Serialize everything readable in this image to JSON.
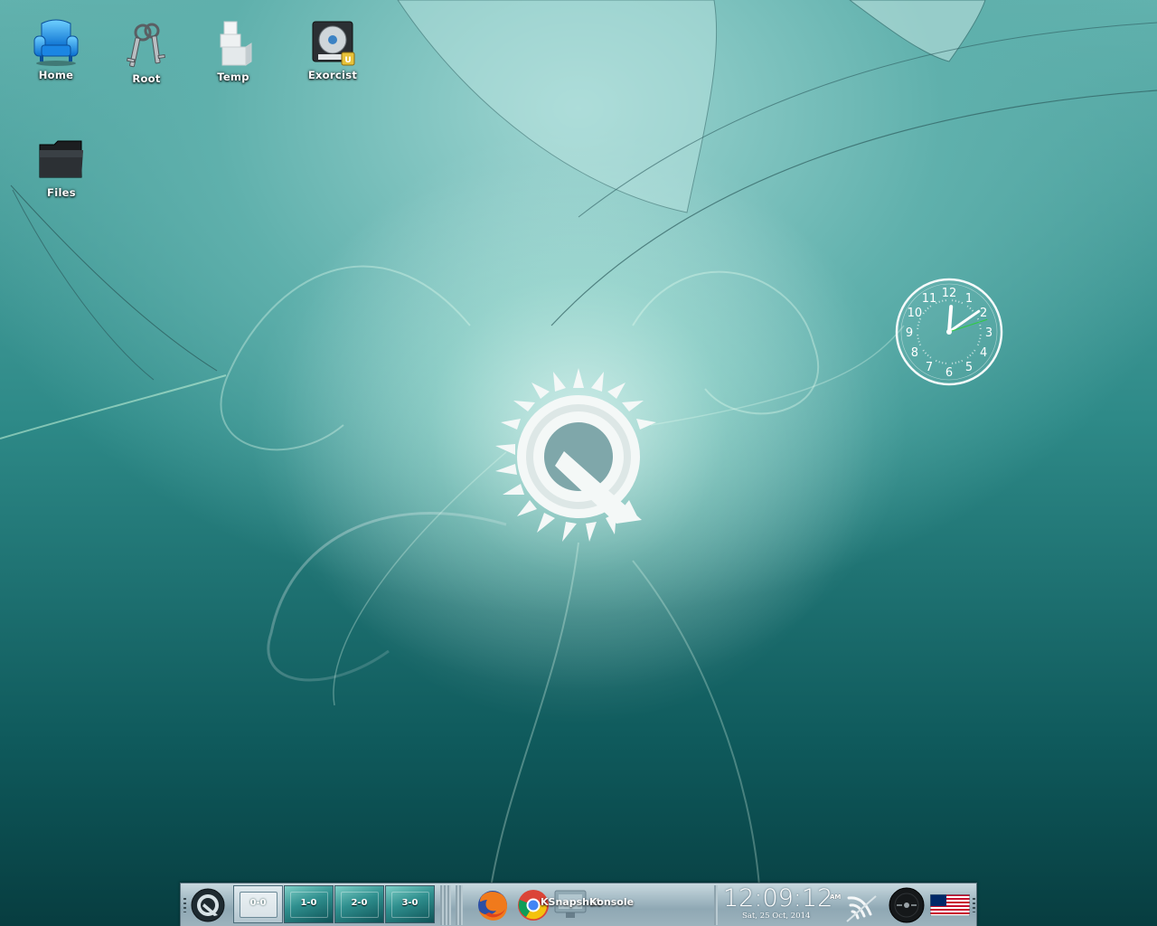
{
  "desktop": {
    "icons": [
      {
        "name": "home",
        "label": "Home"
      },
      {
        "name": "root",
        "label": "Root"
      },
      {
        "name": "temp",
        "label": "Temp"
      },
      {
        "name": "exorcist",
        "label": "Exorcist"
      },
      {
        "name": "files",
        "label": "Files"
      }
    ]
  },
  "clock_widget": {
    "numerals": [
      "12",
      "1",
      "2",
      "3",
      "4",
      "5",
      "6",
      "7",
      "8",
      "9",
      "10",
      "11"
    ],
    "hour": 12,
    "minute": 9,
    "second": 12
  },
  "panel": {
    "pager": [
      {
        "label": "0-0",
        "active": true
      },
      {
        "label": "1-0",
        "active": false
      },
      {
        "label": "2-0",
        "active": false
      },
      {
        "label": "3-0",
        "active": false
      }
    ],
    "launchers": [
      {
        "icon": "firefox-icon"
      },
      {
        "icon": "chrome-icon"
      }
    ],
    "tasks": [
      {
        "label": "KSnapshot"
      },
      {
        "label": "Konsole"
      }
    ],
    "clock": {
      "time": "12:09:12",
      "ampm": "AM",
      "date": "Sat, 25 Oct, 2014"
    },
    "tray": {
      "network": "wifi-icon",
      "media": "media-player-icon",
      "keyboard_layout": "us-flag-icon"
    }
  },
  "colors": {
    "wallpaper_top": "#62b2ae",
    "wallpaper_bottom": "#073d40",
    "panel": "#a6bcc6",
    "accent_green": "#2ecc40"
  }
}
